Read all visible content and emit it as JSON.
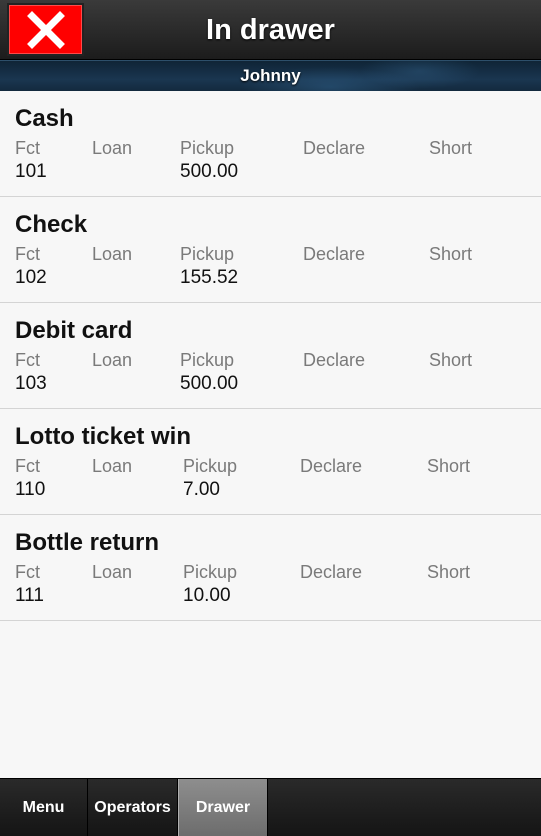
{
  "header": {
    "title": "In drawer",
    "close_icon": "close-x-icon",
    "close_color": "#ff0000"
  },
  "subbar": {
    "operator_name": "Johnny"
  },
  "columns": [
    "Fct",
    "Loan",
    "Pickup",
    "Declare",
    "Short"
  ],
  "items": [
    {
      "title": "Cash",
      "fct": "101",
      "loan": "",
      "pickup": "500.00",
      "declare": "",
      "short": ""
    },
    {
      "title": "Check",
      "fct": "102",
      "loan": "",
      "pickup": "155.52",
      "declare": "",
      "short": ""
    },
    {
      "title": "Debit card",
      "fct": "103",
      "loan": "",
      "pickup": "500.00",
      "declare": "",
      "short": ""
    },
    {
      "title": "Lotto ticket win",
      "fct": "110",
      "loan": "",
      "pickup": "7.00",
      "declare": "",
      "short": ""
    },
    {
      "title": "Bottle return",
      "fct": "111",
      "loan": "",
      "pickup": "10.00",
      "declare": "",
      "short": ""
    }
  ],
  "tabs": [
    {
      "label": "Menu",
      "active": false
    },
    {
      "label": "Operators",
      "active": false
    },
    {
      "label": "Drawer",
      "active": true
    }
  ]
}
